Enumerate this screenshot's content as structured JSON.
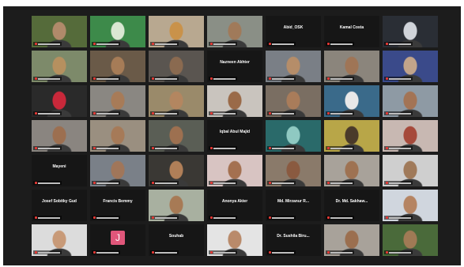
{
  "meeting": {
    "view": "gallery",
    "participants": [
      {
        "name": "",
        "video": true,
        "bg": "#556b3a",
        "face": "#b08a6a"
      },
      {
        "name": "",
        "video": true,
        "bg": "#3d8a4a",
        "face": "#d9e7d2"
      },
      {
        "name": "",
        "video": true,
        "bg": "#b8a890",
        "face": "#c9924a"
      },
      {
        "name": "",
        "video": true,
        "bg": "#8a8f86",
        "face": "#a07a5a"
      },
      {
        "name": "Abid_OSK",
        "video": false
      },
      {
        "name": "Kamal Costa",
        "video": false
      },
      {
        "name": "",
        "video": true,
        "bg": "#2a2e35",
        "face": "#d0d4da"
      },
      {
        "name": "",
        "video": true,
        "bg": "#7d8a6a",
        "face": "#b6905f"
      },
      {
        "name": "",
        "video": true,
        "bg": "#6a5a48",
        "face": "#a67c57"
      },
      {
        "name": "",
        "video": true,
        "bg": "#5a5550",
        "face": "#8a6a50"
      },
      {
        "name": "Nazneen Akhter",
        "video": false
      },
      {
        "name": "",
        "video": true,
        "bg": "#7a7f86",
        "face": "#b58d69"
      },
      {
        "name": "",
        "video": true,
        "bg": "#8b857c",
        "face": "#9f7556"
      },
      {
        "name": "",
        "video": true,
        "bg": "#3a4a8a",
        "face": "#c2a48a"
      },
      {
        "name": "",
        "video": true,
        "bg": "#2a2a2a",
        "face": "#c8283a"
      },
      {
        "name": "",
        "video": true,
        "bg": "#8a8782",
        "face": "#a77b58"
      },
      {
        "name": "",
        "video": true,
        "bg": "#9a8a6a",
        "face": "#b38660"
      },
      {
        "name": "",
        "video": true,
        "bg": "#c9c4be",
        "face": "#9a6a48"
      },
      {
        "name": "",
        "video": true,
        "bg": "#7a6e62",
        "face": "#a97c5a"
      },
      {
        "name": "",
        "video": true,
        "bg": "#3a6a8a",
        "face": "#e8e8e8"
      },
      {
        "name": "",
        "video": true,
        "bg": "#8e9aa4",
        "face": "#a37455"
      },
      {
        "name": "",
        "video": true,
        "bg": "#8a8580",
        "face": "#9c6f50"
      },
      {
        "name": "",
        "video": true,
        "bg": "#9a8f80",
        "face": "#a67a58"
      },
      {
        "name": "",
        "video": true,
        "bg": "#5a5e55",
        "face": "#9d7050"
      },
      {
        "name": "Iqbal Abul Majid",
        "video": false
      },
      {
        "name": "",
        "video": true,
        "bg": "#2a6a6a",
        "face": "#8fc9c2"
      },
      {
        "name": "",
        "video": true,
        "bg": "#b8a648",
        "face": "#4a3a2a"
      },
      {
        "name": "",
        "video": true,
        "bg": "#c8b8b2",
        "face": "#a6493a"
      },
      {
        "name": "Mayeni",
        "video": false
      },
      {
        "name": "",
        "video": true,
        "bg": "#7a8088",
        "face": "#a0765a"
      },
      {
        "name": "",
        "video": true,
        "bg": "#3a3834",
        "face": "#b07f58"
      },
      {
        "name": "",
        "video": true,
        "bg": "#d8c4c2",
        "face": "#a47050"
      },
      {
        "name": "",
        "video": true,
        "bg": "#8a7a6a",
        "face": "#8a5a40"
      },
      {
        "name": "",
        "video": true,
        "bg": "#a8a29a",
        "face": "#9e7252"
      },
      {
        "name": "",
        "video": true,
        "bg": "#cfcfcf",
        "face": "#a07a5a"
      },
      {
        "name": "Josef Sobitky Gud",
        "video": false
      },
      {
        "name": "Francis Bemmy",
        "video": false
      },
      {
        "name": "",
        "video": true,
        "bg": "#a8b0a0",
        "face": "#a77a55"
      },
      {
        "name": "Anonya Akter",
        "video": false
      },
      {
        "name": "Md. Mirzanur R...",
        "video": false
      },
      {
        "name": "Dr. Md. Sakhaw...",
        "video": false
      },
      {
        "name": "",
        "video": true,
        "bg": "#d0d6de",
        "face": "#b58462"
      },
      {
        "name": "",
        "video": true,
        "bg": "#dcdcdc",
        "face": "#c89a78"
      },
      {
        "name": "",
        "video": false,
        "avatar": "J",
        "avatar_color": "#e0567a"
      },
      {
        "name": "Souhab",
        "video": false
      },
      {
        "name": "",
        "video": true,
        "bg": "#e4e4e4",
        "face": "#b98a6a"
      },
      {
        "name": "Dr. Sushila Biru...",
        "video": false
      },
      {
        "name": "",
        "video": true,
        "bg": "#a8a29a",
        "face": "#9b6f4f"
      },
      {
        "name": "",
        "video": true,
        "bg": "#4a6a3a",
        "face": "#a07a55"
      }
    ]
  }
}
